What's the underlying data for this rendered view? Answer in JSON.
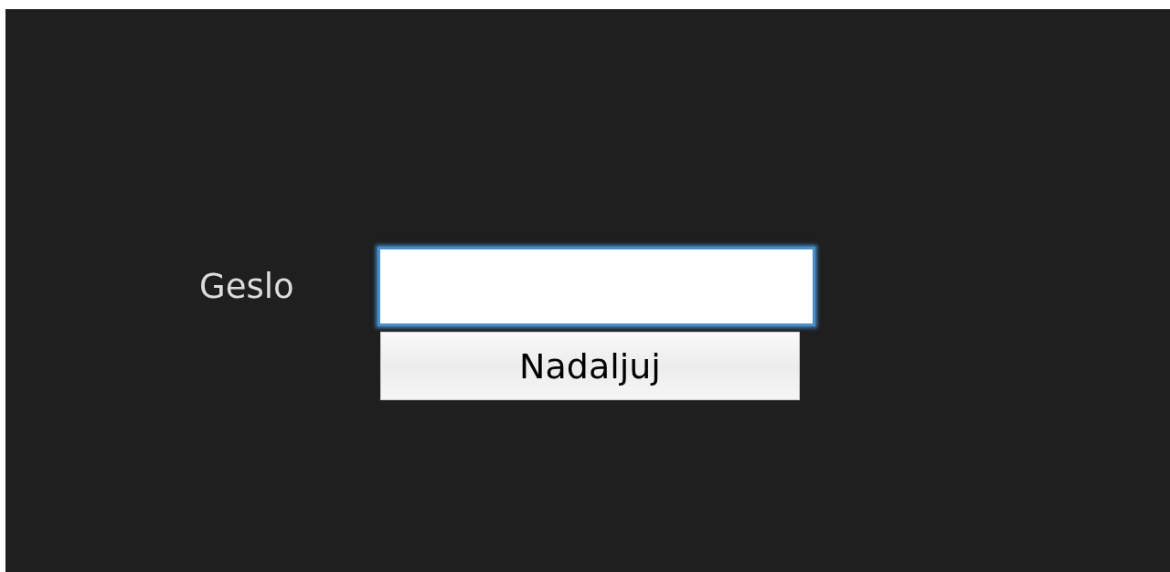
{
  "form": {
    "password_label": "Geslo",
    "password_field": {
      "focused": true
    },
    "submit_button": "Nadaljuj"
  }
}
